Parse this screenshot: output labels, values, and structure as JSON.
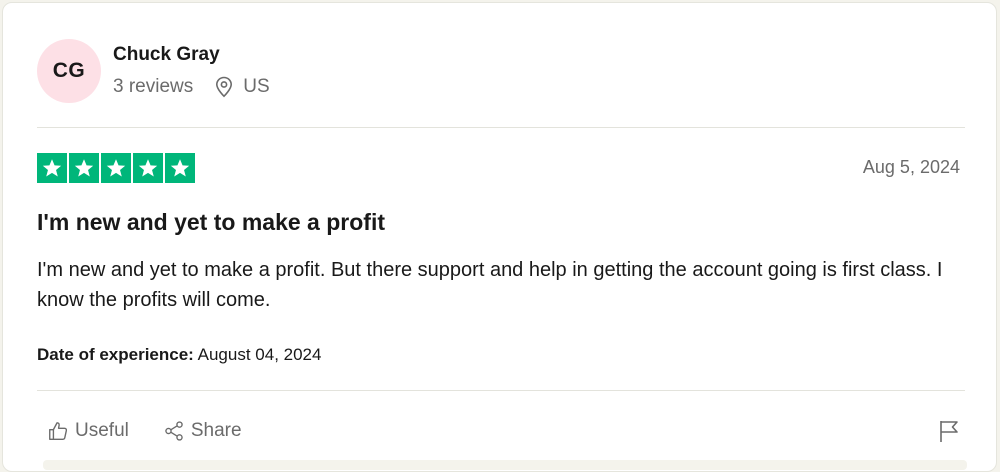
{
  "consumer": {
    "initials": "CG",
    "name": "Chuck Gray",
    "reviews": "3 reviews",
    "country": "US"
  },
  "review": {
    "rating": 5,
    "date": "Aug 5, 2024",
    "title": "I'm new and yet to make a profit",
    "text": "I'm new and yet to make a profit. But there support and help in getting the account going is first class. I know the profits will come.",
    "experience_label": "Date of experience:",
    "experience_date": "August 04, 2024"
  },
  "actions": {
    "useful_label": "Useful",
    "share_label": "Share"
  },
  "colors": {
    "star_green": "#00b67a",
    "avatar_pink": "#fde0e6",
    "muted_text": "#6b6b6b"
  },
  "icons": {
    "location": "location-pin-icon",
    "useful": "thumbs-up-icon",
    "share": "share-icon",
    "report": "flag-icon",
    "star": "star-icon"
  }
}
